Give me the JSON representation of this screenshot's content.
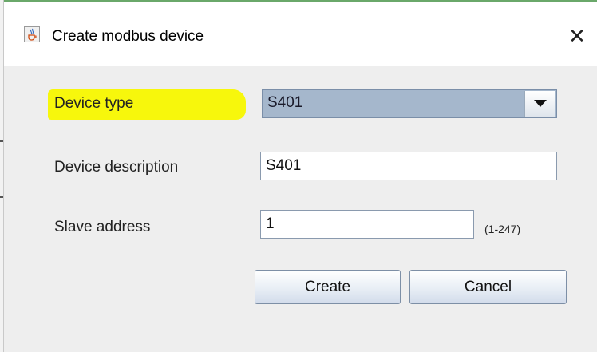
{
  "window": {
    "title": "Create modbus device",
    "icon": "java-cup-icon",
    "close_glyph": "✕"
  },
  "form": {
    "device_type": {
      "label": "Device type",
      "value": "S401",
      "label_highlighted": true
    },
    "device_description": {
      "label": "Device description",
      "value": "S401"
    },
    "slave_address": {
      "label": "Slave address",
      "value": "1",
      "hint": "(1-247)"
    }
  },
  "buttons": {
    "create": "Create",
    "cancel": "Cancel"
  },
  "colors": {
    "highlight": "#f7f70c",
    "combo_selected_bg": "#a5b7cc",
    "dialog_bg": "#eeeeee"
  }
}
